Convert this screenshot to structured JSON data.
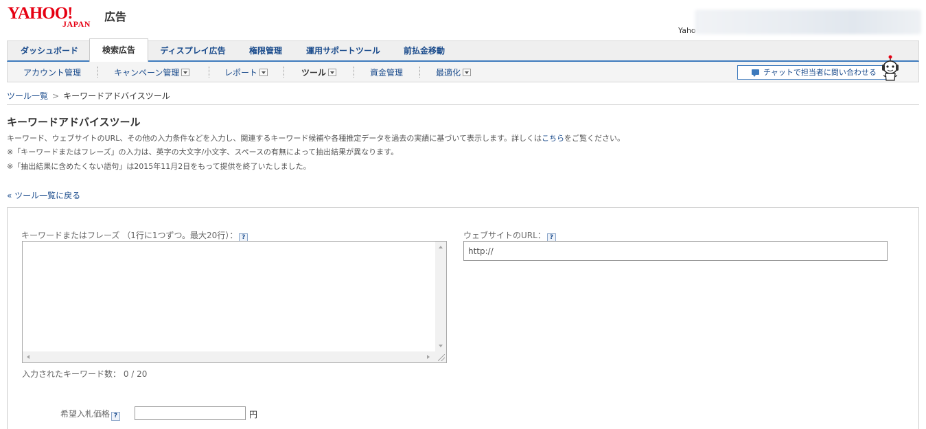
{
  "brand": {
    "logo_text": "YAHOO!",
    "logo_sub": "JAPAN",
    "product": "広告",
    "logo_color": "#e60012"
  },
  "user": {
    "name_visible": "Yaho"
  },
  "tabs": [
    {
      "label": "ダッシュボード"
    },
    {
      "label": "検索広告",
      "active": true
    },
    {
      "label": "ディスプレイ広告"
    },
    {
      "label": "権限管理"
    },
    {
      "label": "運用サポートツール"
    },
    {
      "label": "前払金移動"
    }
  ],
  "subnav": {
    "items": [
      {
        "label": "アカウント管理"
      },
      {
        "label": "キャンペーン管理"
      },
      {
        "label": "レポート"
      },
      {
        "label": "ツール",
        "current": true
      },
      {
        "label": "資金管理"
      },
      {
        "label": "最適化"
      }
    ],
    "chat_label": "チャットで担当者に問い合わせる"
  },
  "breadcrumb": {
    "parent": "ツール一覧",
    "separator": ">",
    "current": "キーワードアドバイスツール"
  },
  "page": {
    "title": "キーワードアドバイスツール",
    "desc1_pre": "キーワード、ウェブサイトのURL、その他の入力条件などを入力し、関連するキーワード候補や各種推定データを過去の実績に基づいて表示します。詳しくは",
    "desc1_link": "こちら",
    "desc1_post": "をご覧ください。",
    "note1": "※「キーワードまたはフレーズ」の入力は、英字の大文字/小文字、スペースの有無によって抽出結果が異なります。",
    "note2": "※「抽出結果に含めたくない語句」は2015年11月2日をもって提供を終了いたしました。",
    "back_link": "« ツール一覧に戻る"
  },
  "form": {
    "keyword_label": "キーワードまたはフレーズ （1行に1つずつ。最大20行）：",
    "url_label": "ウェブサイトのURL：",
    "url_value": "http://",
    "help_glyph": "?",
    "count_label": "入力されたキーワード数：",
    "count_value": "0 / 20",
    "bid_label": "希望入札価格",
    "bid_unit": "円"
  },
  "colors": {
    "link": "#1a4b8c",
    "accent": "#3d7abd"
  }
}
